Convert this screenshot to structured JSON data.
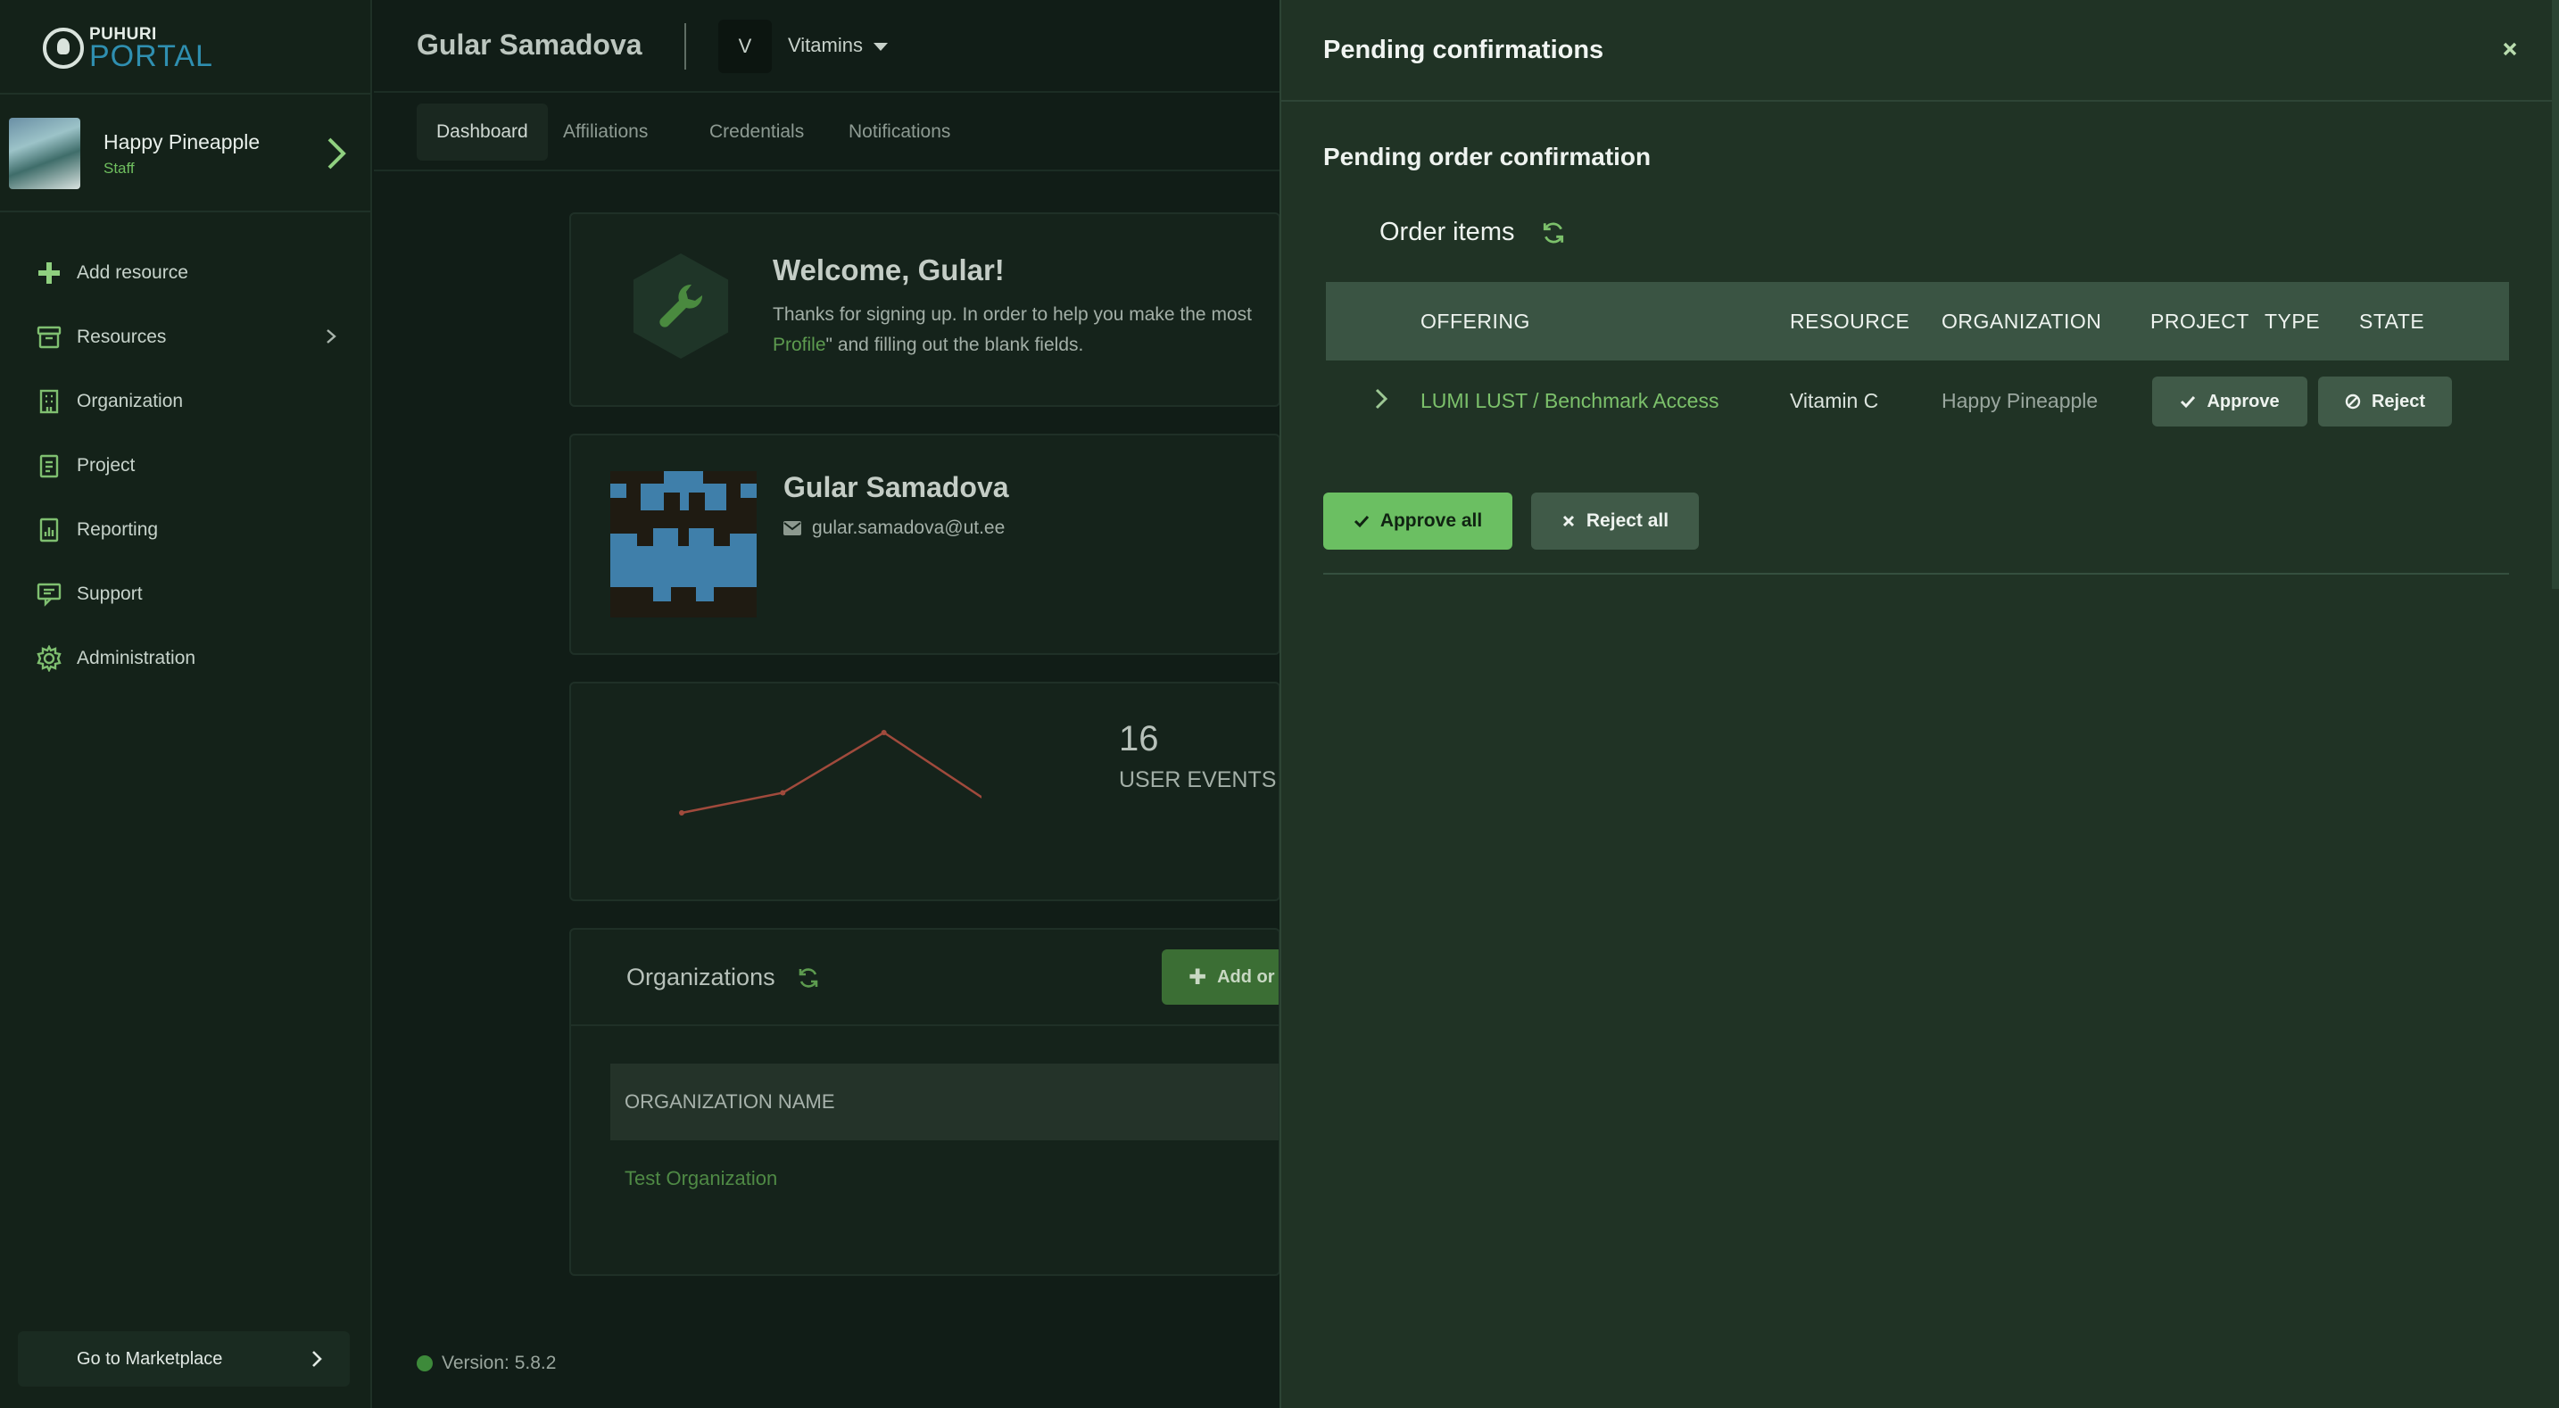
{
  "sidebar": {
    "logo": {
      "top": "PUHURI",
      "bottom": "PORTAL"
    },
    "user": {
      "name": "Happy Pineapple",
      "role": "Staff"
    },
    "items": [
      {
        "label": "Add resource",
        "icon": "plus-icon"
      },
      {
        "label": "Resources",
        "icon": "archive-icon"
      },
      {
        "label": "Organization",
        "icon": "building-icon"
      },
      {
        "label": "Project",
        "icon": "clipboard-icon"
      },
      {
        "label": "Reporting",
        "icon": "report-icon"
      },
      {
        "label": "Support",
        "icon": "support-icon"
      },
      {
        "label": "Administration",
        "icon": "gear-icon"
      }
    ],
    "marketplace": "Go to Marketplace"
  },
  "header": {
    "user_name": "Gular Samadova",
    "org_badge": "V",
    "org_name": "Vitamins",
    "tabs": [
      "Dashboard",
      "Affiliations",
      "Credentials",
      "Notifications"
    ],
    "active_tab": "Dashboard"
  },
  "dashboard": {
    "welcome_title": "Welcome, Gular!",
    "welcome_text_1": "Thanks for signing up. In order to help you make the most",
    "welcome_link": "Profile",
    "welcome_text_2": "\" and filling out the blank fields.",
    "profile_name": "Gular Samadova",
    "profile_email": "gular.samadova@ut.ee",
    "stat_value": "16",
    "stat_label": "USER EVENTS (",
    "organizations_title": "Organizations",
    "add_org_label": "Add or",
    "org_table_header": "ORGANIZATION NAME",
    "org_rows": [
      "Test Organization"
    ],
    "version": "Version: 5.8.2"
  },
  "chart_data": {
    "type": "line",
    "x": [
      1,
      2,
      3,
      4
    ],
    "values": [
      2,
      5,
      14,
      4
    ],
    "ylim": [
      0,
      16
    ],
    "color": "#a04a3c",
    "grid": false
  },
  "drawer": {
    "title": "Pending confirmations",
    "section_title": "Pending order confirmation",
    "items_title": "Order items",
    "columns": [
      "OFFERING",
      "RESOURCE",
      "ORGANIZATION",
      "PROJECT",
      "TYPE",
      "STATE"
    ],
    "rows": [
      {
        "offering": "LUMI LUST / Benchmark Access",
        "resource": "Vitamin C",
        "organization": "Happy Pineapple",
        "approve": "Approve",
        "reject": "Reject"
      }
    ],
    "approve_all": "Approve all",
    "reject_all": "Reject all"
  },
  "colors": {
    "accent_green": "#6bbf62",
    "link_green": "#7cc16b",
    "drawer_bg": "#203325",
    "brand_blue": "#2f8fb0"
  }
}
